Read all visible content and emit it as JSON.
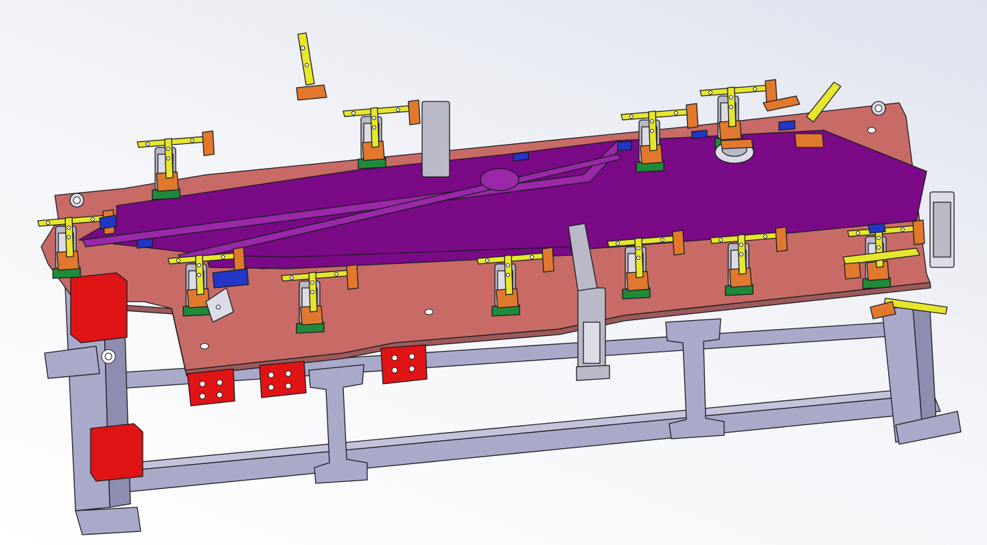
{
  "view": {
    "background_gradient": [
      "#dfe3ee",
      "#ffffff"
    ]
  },
  "model": {
    "colors": {
      "frame": "#a9a9c9",
      "base_plate": "#c86b66",
      "workpiece": "#7a0a86",
      "clamp_arms": "#e6e62c",
      "clamp_pads": "#e0782e",
      "locator_blocks": "#e01414",
      "clamp_bases": "#1f8a3a",
      "stops": "#2237c8"
    }
  }
}
